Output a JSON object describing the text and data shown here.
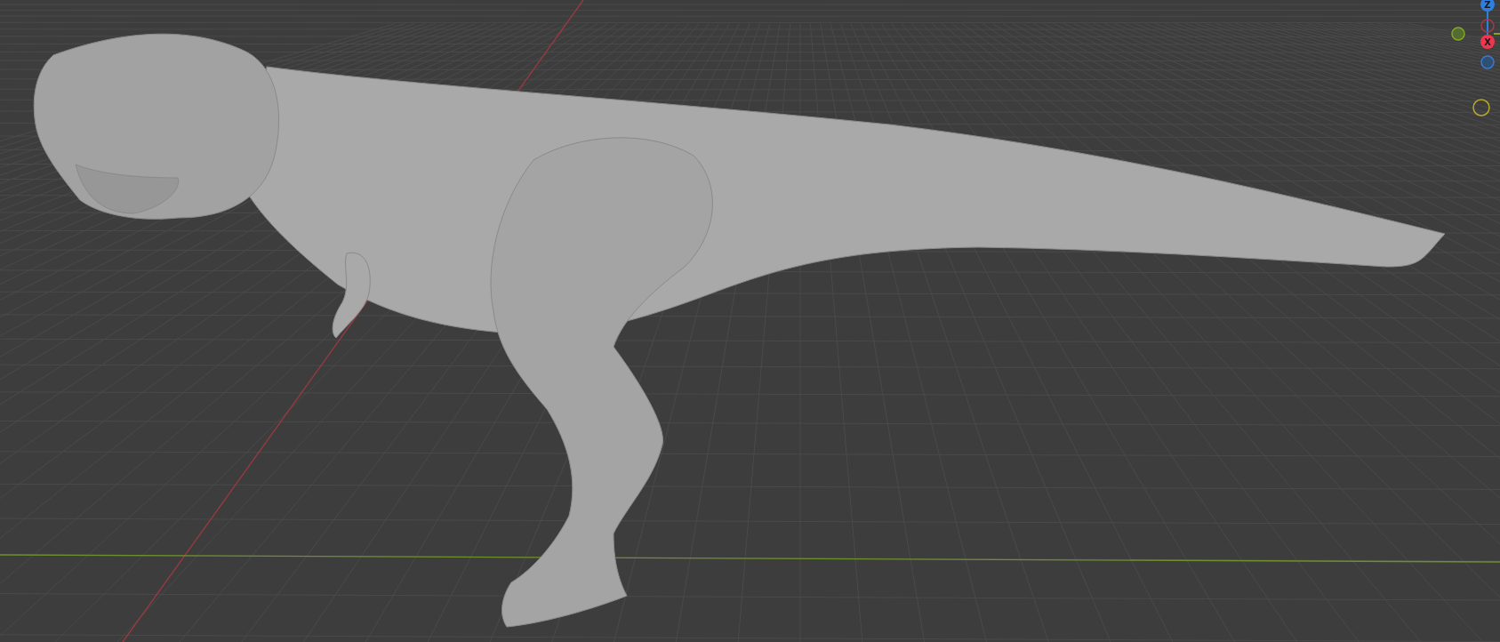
{
  "viewport": {
    "gizmo": {
      "axes": [
        {
          "label": "Z",
          "color": "#2f7fe0"
        },
        {
          "label": "X",
          "color": "#f0364f"
        }
      ]
    }
  }
}
